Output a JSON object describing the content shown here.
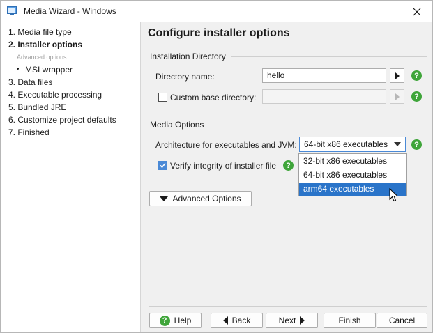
{
  "window": {
    "title": "Media Wizard - Windows"
  },
  "sidebar": {
    "steps": [
      {
        "label": "1. Media file type"
      },
      {
        "label": "2. Installer options",
        "active": true
      },
      {
        "label": "Advanced options:"
      },
      {
        "label": "MSI wrapper"
      },
      {
        "label": "3. Data files"
      },
      {
        "label": "4. Executable processing"
      },
      {
        "label": "5. Bundled JRE"
      },
      {
        "label": "6. Customize project defaults"
      },
      {
        "label": "7. Finished"
      }
    ]
  },
  "main": {
    "title": "Configure installer options",
    "installation_directory": {
      "section_label": "Installation Directory",
      "directory_name_label": "Directory name:",
      "directory_name_value": "hello",
      "custom_base_label": "Custom base directory:",
      "custom_base_checked": false,
      "custom_base_value": ""
    },
    "media_options": {
      "section_label": "Media Options",
      "architecture_label": "Architecture for executables and JVM:",
      "architecture_value": "64-bit x86 executables",
      "architecture_options": [
        "32-bit x86 executables",
        "64-bit x86 executables",
        "arm64 executables"
      ],
      "highlighted_option": "arm64 executables",
      "verify_label": "Verify integrity of installer file",
      "verify_checked": true
    },
    "advanced_options_label": "Advanced Options"
  },
  "footer": {
    "help_label": "Help",
    "back_label": "Back",
    "next_label": "Next",
    "finish_label": "Finish",
    "cancel_label": "Cancel"
  },
  "colors": {
    "accent": "#2a74c9",
    "help_green": "#3fa53a",
    "checkbox_blue": "#4a89d6"
  },
  "icons": [
    "app-icon",
    "close-icon",
    "arrow-right-icon",
    "help-icon",
    "checkmark-icon",
    "chevron-down-icon",
    "triangle-down-icon",
    "triangle-left-icon",
    "triangle-right-icon",
    "mouse-pointer-icon"
  ]
}
